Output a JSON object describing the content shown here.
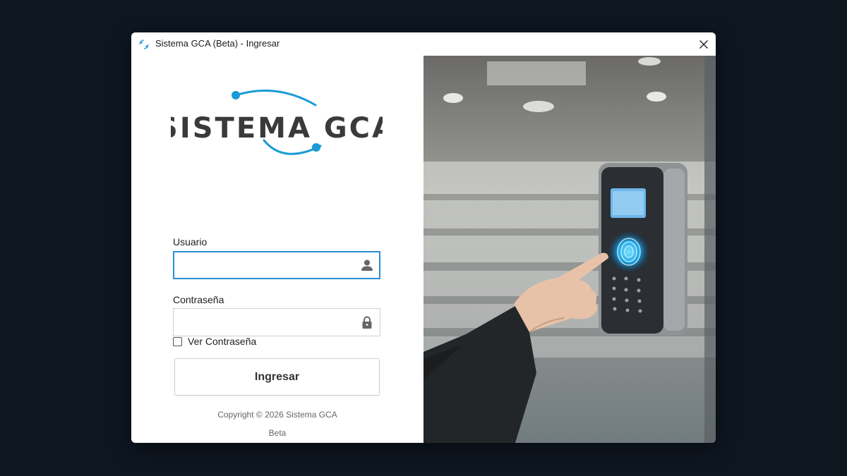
{
  "window": {
    "title": "Sistema GCA (Beta) - Ingresar"
  },
  "logo": {
    "text": "SISTEMA GCA",
    "accent_color": "#1a9ad6"
  },
  "form": {
    "username_label": "Usuario",
    "username_value": "",
    "password_label": "Contraseña",
    "password_value": "",
    "show_password_label": "Ver Contraseña",
    "show_password_checked": false,
    "submit_label": "Ingresar"
  },
  "footer": {
    "copyright": "Copyright © 2026 Sistema GCA",
    "beta": "Beta"
  },
  "icons": {
    "app": "app-logo-icon",
    "close": "close-icon",
    "user": "user-icon",
    "lock": "lock-icon"
  },
  "colors": {
    "focus": "#2a8fd4",
    "background": "#0e1620"
  }
}
